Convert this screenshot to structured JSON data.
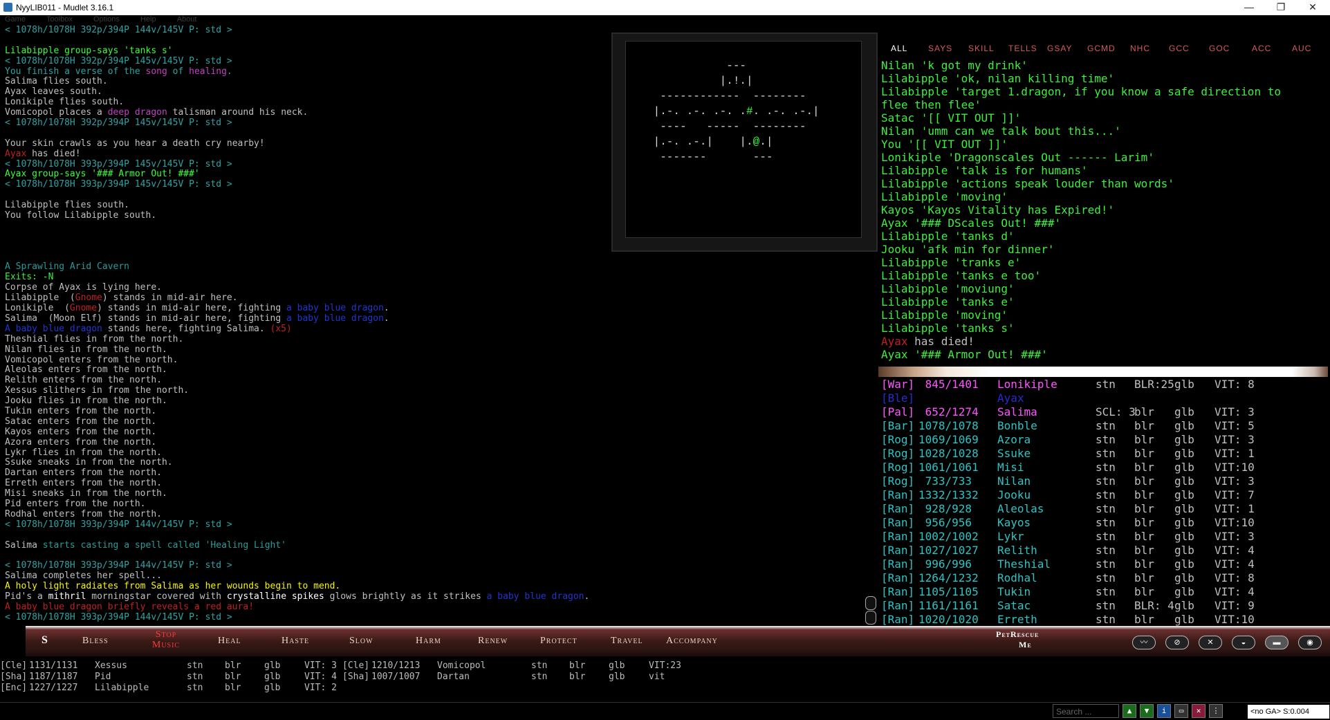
{
  "window": {
    "title": "NyyLIB011 - Mudlet 3.16.1",
    "minimize": "—",
    "maximize": "❐",
    "close": "✕"
  },
  "menu": [
    "Game",
    "Toolbox",
    "Options",
    "Help",
    "About"
  ],
  "colors": {
    "prompt": "#2ea3a3",
    "grey": "#c0c0c0",
    "green": "#3df03d",
    "brightgreen": "#38ff38",
    "red": "#c02020",
    "blue": "#1f36d0",
    "magenta": "#c040c0",
    "magenta2": "#ff55ff",
    "yellow": "#f6f600",
    "white": "#ffffff",
    "darkcyan": "#2a9a9a",
    "dim": "#5a6a9a"
  },
  "console": [
    [
      {
        "t": "< 1078h/1078H 392p/394P 144v/145V P: std >",
        "c": "prompt"
      }
    ],
    [],
    [
      {
        "t": "Lilabipple group-says 'tanks s'",
        "c": "brightgreen"
      }
    ],
    [
      {
        "t": "< 1078h/1078H 392p/394P 145v/145V P: std >",
        "c": "prompt"
      }
    ],
    [
      {
        "t": "You finish a verse of the ",
        "c": "prompt"
      },
      {
        "t": "song",
        "c": "magenta"
      },
      {
        "t": " of ",
        "c": "prompt"
      },
      {
        "t": "healing",
        "c": "magenta"
      },
      {
        "t": ".",
        "c": "prompt"
      }
    ],
    [
      {
        "t": "Salima flies south.",
        "c": "grey"
      }
    ],
    [
      {
        "t": "Ayax leaves south.",
        "c": "grey"
      }
    ],
    [
      {
        "t": "Lonikiple flies south.",
        "c": "grey"
      }
    ],
    [
      {
        "t": "Vomicopol places a ",
        "c": "grey"
      },
      {
        "t": "deep",
        "c": "magenta"
      },
      {
        "t": " ",
        "c": "grey"
      },
      {
        "t": "dragon",
        "c": "magenta"
      },
      {
        "t": " talisman around his neck.",
        "c": "grey"
      }
    ],
    [
      {
        "t": "< 1078h/1078H 392p/394P 145v/145V P: std >",
        "c": "prompt"
      }
    ],
    [],
    [
      {
        "t": "Your skin crawls as you hear a death cry nearby!",
        "c": "grey"
      }
    ],
    [
      {
        "t": "Ayax",
        "c": "red"
      },
      {
        "t": " has died!",
        "c": "grey"
      }
    ],
    [
      {
        "t": "< 1078h/1078H 393p/394P 145v/145V P: std >",
        "c": "prompt"
      }
    ],
    [
      {
        "t": "Ayax group-says '### Armor Out! ###'",
        "c": "brightgreen"
      }
    ],
    [
      {
        "t": "< 1078h/1078H 393p/394P 145v/145V P: std >",
        "c": "prompt"
      }
    ],
    [],
    [
      {
        "t": "Lilabipple flies south.",
        "c": "grey"
      }
    ],
    [
      {
        "t": "You follow Lilabipple south.",
        "c": "grey"
      }
    ],
    [],
    [],
    [],
    [],
    [
      {
        "t": "A Sprawling Arid Cavern",
        "c": "darkcyan"
      }
    ],
    [
      {
        "t": "Exits: -N",
        "c": "green"
      }
    ],
    [
      {
        "t": "Corpse of Ayax is lying here.",
        "c": "grey"
      }
    ],
    [
      {
        "t": "Lilabipple  (",
        "c": "grey"
      },
      {
        "t": "Gnome",
        "c": "red"
      },
      {
        "t": ") stands in mid-air here.",
        "c": "grey"
      }
    ],
    [
      {
        "t": "Lonikiple  (",
        "c": "grey"
      },
      {
        "t": "Gnome",
        "c": "red"
      },
      {
        "t": ") stands in mid-air here, fighting ",
        "c": "grey"
      },
      {
        "t": "a baby blue dragon",
        "c": "blue"
      },
      {
        "t": ".",
        "c": "grey"
      }
    ],
    [
      {
        "t": "Salima  (Moon Elf) stands in mid-air here, fighting ",
        "c": "grey"
      },
      {
        "t": "a baby blue dragon",
        "c": "blue"
      },
      {
        "t": ".",
        "c": "grey"
      }
    ],
    [
      {
        "t": "A baby blue dragon",
        "c": "blue"
      },
      {
        "t": " stands here, fighting Salima. ",
        "c": "grey"
      },
      {
        "t": "(x5)",
        "c": "red"
      }
    ],
    [
      {
        "t": "Theshial flies in from the north.",
        "c": "grey"
      }
    ],
    [
      {
        "t": "Nilan flies in from the north.",
        "c": "grey"
      }
    ],
    [
      {
        "t": "Vomicopol enters from the north.",
        "c": "grey"
      }
    ],
    [
      {
        "t": "Aleolas enters from the north.",
        "c": "grey"
      }
    ],
    [
      {
        "t": "Relith enters from the north.",
        "c": "grey"
      }
    ],
    [
      {
        "t": "Xessus slithers in from the north.",
        "c": "grey"
      }
    ],
    [
      {
        "t": "Jooku flies in from the north.",
        "c": "grey"
      }
    ],
    [
      {
        "t": "Tukin enters from the north.",
        "c": "grey"
      }
    ],
    [
      {
        "t": "Satac enters from the north.",
        "c": "grey"
      }
    ],
    [
      {
        "t": "Kayos enters from the north.",
        "c": "grey"
      }
    ],
    [
      {
        "t": "Azora enters from the north.",
        "c": "grey"
      }
    ],
    [
      {
        "t": "Lykr flies in from the north.",
        "c": "grey"
      }
    ],
    [
      {
        "t": "Ssuke sneaks in from the north.",
        "c": "grey"
      }
    ],
    [
      {
        "t": "Dartan enters from the north.",
        "c": "grey"
      }
    ],
    [
      {
        "t": "Erreth enters from the north.",
        "c": "grey"
      }
    ],
    [
      {
        "t": "Misi sneaks in from the north.",
        "c": "grey"
      }
    ],
    [
      {
        "t": "Pid enters from the north.",
        "c": "grey"
      }
    ],
    [
      {
        "t": "Rodhal enters from the north.",
        "c": "grey"
      }
    ],
    [
      {
        "t": "< 1078h/1078H 393p/394P 144v/145V P: std >",
        "c": "prompt"
      }
    ],
    [],
    [
      {
        "t": "Salima ",
        "c": "grey"
      },
      {
        "t": "starts casting a spell called 'Healing Light'",
        "c": "darkcyan"
      }
    ],
    [],
    [
      {
        "t": "< 1078h/1078H 393p/394P 144v/145V P: std >",
        "c": "prompt"
      }
    ],
    [
      {
        "t": "Salima completes her spell...",
        "c": "grey"
      }
    ],
    [
      {
        "t": "A holy light radiates from Salima as her wounds begin to mend.",
        "c": "yellow"
      }
    ],
    [
      {
        "t": "Pid's a ",
        "c": "grey"
      },
      {
        "t": "mithril",
        "c": "white"
      },
      {
        "t": " morningstar covered with ",
        "c": "grey"
      },
      {
        "t": "crystalline",
        "c": "white"
      },
      {
        "t": " ",
        "c": "grey"
      },
      {
        "t": "spikes",
        "c": "white"
      },
      {
        "t": " glows brightly as it strikes ",
        "c": "grey"
      },
      {
        "t": "a baby blue dragon",
        "c": "blue"
      },
      {
        "t": ".",
        "c": "grey"
      }
    ],
    [
      {
        "t": "A baby blue dragon briefly reveals a ",
        "c": "red"
      },
      {
        "t": "red",
        "c": "red"
      },
      {
        "t": " aura!",
        "c": "red"
      }
    ],
    [
      {
        "t": "< 1078h/1078H 393p/394P 144v/145V P: std >",
        "c": "prompt"
      }
    ]
  ],
  "map": {
    "lines": [
      "            ---",
      "           |.!.|",
      "  ------------  --------",
      " |.-. .-. .-. .#. .-. .-.|",
      "  ----   -----  --------",
      " |.-. .-.|    |.@.|",
      "  -------       ---"
    ]
  },
  "chat_tabs": [
    "ALL",
    "SAYS",
    "SKILL",
    "TELLS",
    "GSAY",
    "GCMD",
    "NHC",
    "GCC",
    "GOC",
    "ACC",
    "AUC"
  ],
  "chat": [
    {
      "t": "Nilan 'k got my drink'",
      "c": "green"
    },
    {
      "t": "Lilabipple 'ok, nilan killing time'",
      "c": "green"
    },
    {
      "t": "Lilabipple 'target 1.dragon, if you know a safe direction to",
      "c": "green"
    },
    {
      "t": "flee then flee'",
      "c": "green"
    },
    {
      "t": "Satac '[[ VIT OUT ]]'",
      "c": "green"
    },
    {
      "t": "Nilan 'umm can we talk bout this...'",
      "c": "green"
    },
    {
      "t": "You '[[ VIT OUT ]]'",
      "c": "green"
    },
    {
      "t": "Lonikiple 'Dragonscales Out ------ Larim'",
      "c": "green"
    },
    {
      "t": "Lilabipple 'talk is for humans'",
      "c": "green"
    },
    {
      "t": "Lilabipple 'actions speak louder than words'",
      "c": "green"
    },
    {
      "t": "Lilabipple 'moving'",
      "c": "green"
    },
    {
      "t": "Kayos 'Kayos Vitality has Expired!'",
      "c": "green"
    },
    {
      "t": "Ayax '### DScales Out! ###'",
      "c": "green"
    },
    {
      "t": "Lilabipple 'tanks d'",
      "c": "green"
    },
    {
      "t": "Jooku 'afk min for dinner'",
      "c": "green"
    },
    {
      "t": "Lilabipple 'tranks e'",
      "c": "green"
    },
    {
      "t": "Lilabipple 'tanks e too'",
      "c": "green"
    },
    {
      "t": "Lilabipple 'moviung'",
      "c": "green"
    },
    {
      "t": "Lilabipple 'tanks e'",
      "c": "green"
    },
    {
      "t": "Lilabipple 'moving'",
      "c": "green"
    },
    {
      "t": "Lilabipple 'tanks s'",
      "c": "green"
    },
    {
      "dead": "Ayax",
      "rest": " has died!"
    },
    {
      "t": "Ayax '### Armor Out! ###'",
      "c": "green"
    }
  ],
  "group": [
    {
      "cls": "[War]",
      "hp": " 845/1401",
      "name": "Lonikiple",
      "pos": "stn",
      "b": "BLR:25",
      "g": "glb",
      "vit": "VIT: 8",
      "color": "#ff55ff"
    },
    {
      "cls": "[Ble]",
      "hp": "",
      "name": "Ayax",
      "pos": "",
      "b": "",
      "g": "",
      "vit": "",
      "color": "#2a2ad0"
    },
    {
      "cls": "[Pal]",
      "hp": " 652/1274",
      "name": "Salima",
      "pos": "SCL: 3",
      "b": "blr",
      "g": "glb",
      "vit": "VIT: 3",
      "color": "#ff55ff"
    },
    {
      "cls": "[Bar]",
      "hp": "1078/1078",
      "name": "Bonble",
      "pos": "stn",
      "b": "blr",
      "g": "glb",
      "vit": "VIT: 5",
      "color": "#2ec4c4"
    },
    {
      "cls": "[Rog]",
      "hp": "1069/1069",
      "name": "Azora",
      "pos": "stn",
      "b": "blr",
      "g": "glb",
      "vit": "VIT: 3",
      "color": "#2ec4c4"
    },
    {
      "cls": "[Rog]",
      "hp": "1028/1028",
      "name": "Ssuke",
      "pos": "stn",
      "b": "blr",
      "g": "glb",
      "vit": "VIT: 1",
      "color": "#2ec4c4"
    },
    {
      "cls": "[Rog]",
      "hp": "1061/1061",
      "name": "Misi",
      "pos": "stn",
      "b": "blr",
      "g": "glb",
      "vit": "VIT:10",
      "color": "#2ec4c4"
    },
    {
      "cls": "[Rog]",
      "hp": " 733/733",
      "name": "Nilan",
      "pos": "stn",
      "b": "blr",
      "g": "glb",
      "vit": "VIT: 3",
      "color": "#2ec4c4"
    },
    {
      "cls": "[Ran]",
      "hp": "1332/1332",
      "name": "Jooku",
      "pos": "stn",
      "b": "blr",
      "g": "glb",
      "vit": "VIT: 7",
      "color": "#2ec4c4"
    },
    {
      "cls": "[Ran]",
      "hp": " 928/928",
      "name": "Aleolas",
      "pos": "stn",
      "b": "blr",
      "g": "glb",
      "vit": "VIT: 1",
      "color": "#2ec4c4"
    },
    {
      "cls": "[Ran]",
      "hp": " 956/956",
      "name": "Kayos",
      "pos": "stn",
      "b": "blr",
      "g": "glb",
      "vit": "VIT:10",
      "color": "#2ec4c4"
    },
    {
      "cls": "[Ran]",
      "hp": "1002/1002",
      "name": "Lykr",
      "pos": "stn",
      "b": "blr",
      "g": "glb",
      "vit": "VIT: 3",
      "color": "#2ec4c4"
    },
    {
      "cls": "[Ran]",
      "hp": "1027/1027",
      "name": "Relith",
      "pos": "stn",
      "b": "blr",
      "g": "glb",
      "vit": "VIT: 4",
      "color": "#2ec4c4"
    },
    {
      "cls": "[Ran]",
      "hp": " 996/996",
      "name": "Theshial",
      "pos": "stn",
      "b": "blr",
      "g": "glb",
      "vit": "VIT: 4",
      "color": "#2ec4c4"
    },
    {
      "cls": "[Ran]",
      "hp": "1264/1232",
      "name": "Rodhal",
      "pos": "stn",
      "b": "blr",
      "g": "glb",
      "vit": "VIT: 8",
      "color": "#2ec4c4"
    },
    {
      "cls": "[Ran]",
      "hp": "1105/1105",
      "name": "Tukin",
      "pos": "stn",
      "b": "blr",
      "g": "glb",
      "vit": "VIT: 4",
      "color": "#2ec4c4"
    },
    {
      "cls": "[Ran]",
      "hp": "1161/1161",
      "name": "Satac",
      "pos": "stn",
      "b": "BLR: 4",
      "g": "glb",
      "vit": "VIT: 9",
      "color": "#2ec4c4"
    },
    {
      "cls": "[Ran]",
      "hp": "1020/1020",
      "name": "Erreth",
      "pos": "stn",
      "b": "blr",
      "g": "glb",
      "vit": "VIT:10",
      "color": "#2ec4c4"
    }
  ],
  "buttons": {
    "s_label": "S",
    "items": [
      "Bless",
      "Stop Music",
      "Heal",
      "Haste",
      "Slow",
      "Harm",
      "Renew",
      "Protect",
      "Travel",
      "Accompany"
    ],
    "pet_rescue_1": "PetRescue",
    "pet_rescue_2": "Me",
    "icons": [
      "heartbeat-icon",
      "no-sneak-icon",
      "cross-swords-icon",
      "shield-icon",
      "helmet-icon",
      "eye-icon"
    ]
  },
  "bottom_group": [
    {
      "cls": "[Cle]",
      "hp": "1131/1131",
      "name": "Xessus",
      "pos": "stn",
      "b": "blr",
      "g": "glb",
      "vit": "VIT: 3",
      "cls2": "[Cle]",
      "hp2": "1210/1213",
      "name2": "Vomicopol",
      "pos2": "stn",
      "b2": "blr",
      "g2": "glb",
      "vit2": "VIT:23"
    },
    {
      "cls": "[Sha]",
      "hp": "1187/1187",
      "name": "Pid",
      "pos": "stn",
      "b": "blr",
      "g": "glb",
      "vit": "VIT: 4",
      "cls2": "[Sha]",
      "hp2": "1007/1007",
      "name2": "Dartan",
      "pos2": "stn",
      "b2": "blr",
      "g2": "glb",
      "vit2": "vit"
    },
    {
      "cls": "[Enc]",
      "hp": "1227/1227",
      "name": "Lilabipple",
      "pos": "stn",
      "b": "blr",
      "g": "glb",
      "vit": "VIT: 2",
      "cls2": "",
      "hp2": "",
      "name2": "",
      "pos2": "",
      "b2": "",
      "g2": "",
      "vit2": ""
    }
  ],
  "status": {
    "search_placeholder": "Search ...",
    "ga_info": "<no GA> S:0.004"
  }
}
